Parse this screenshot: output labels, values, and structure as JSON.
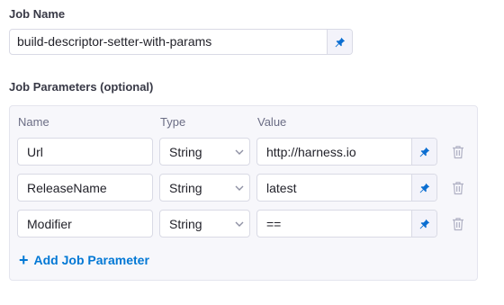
{
  "job_name": {
    "label": "Job Name",
    "value": "build-descriptor-setter-with-params"
  },
  "job_parameters": {
    "label": "Job Parameters (optional)",
    "columns": {
      "name": "Name",
      "type": "Type",
      "value": "Value"
    },
    "rows": [
      {
        "name": "Url",
        "type": "String",
        "value": "http://harness.io"
      },
      {
        "name": "ReleaseName",
        "type": "String",
        "value": "latest"
      },
      {
        "name": "Modifier",
        "type": "String",
        "value": "=="
      }
    ],
    "add_label": "Add Job Parameter"
  },
  "icons": {
    "pin": "pin-icon",
    "chevron": "chevron-down-icon",
    "trash": "trash-icon",
    "plus": "plus-icon"
  },
  "colors": {
    "accent": "#0278d5",
    "pin": "#0b6ed1",
    "panel": "#f7f7fb",
    "border": "#d9dae5"
  }
}
